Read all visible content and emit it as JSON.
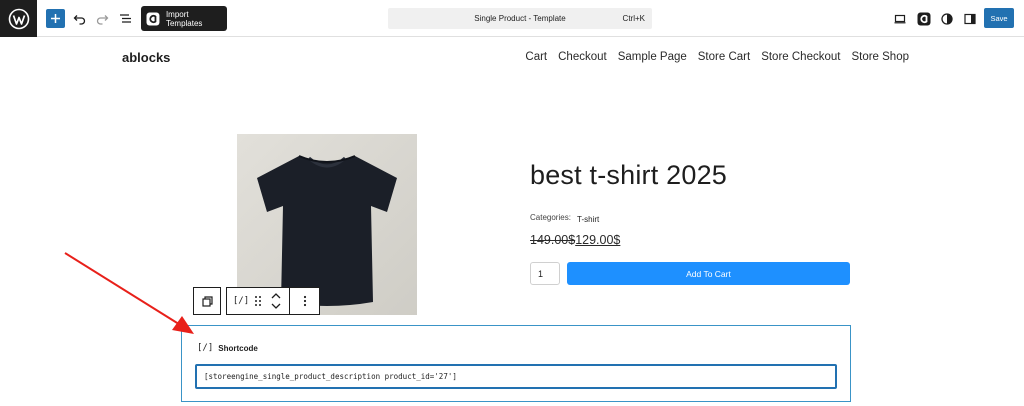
{
  "toolbar": {
    "import_templates_label": "Import Templates",
    "document_title": "Single Product - Template",
    "shortcut": "Ctrl+K",
    "save_label": "Save"
  },
  "site": {
    "title": "ablocks",
    "nav": [
      "Cart",
      "Checkout",
      "Sample Page",
      "Store Cart",
      "Store Checkout",
      "Store Shop"
    ]
  },
  "product": {
    "title": "best t-shirt 2025",
    "categories_label": "Categories:",
    "category": "T-shirt",
    "price_old": "149.00$",
    "price_new": "129.00$",
    "quantity": "1",
    "add_to_cart": "Add To Cart"
  },
  "block_toolbar": {
    "block_icon_label": "[/]"
  },
  "shortcode_block": {
    "icon_label": "[/]",
    "label": "Shortcode",
    "value": "[storeengine_single_product_description product_id='27']"
  },
  "colors": {
    "accent": "#2271b1",
    "cart_button": "#1e90ff",
    "annotation_arrow": "#e8201a"
  }
}
